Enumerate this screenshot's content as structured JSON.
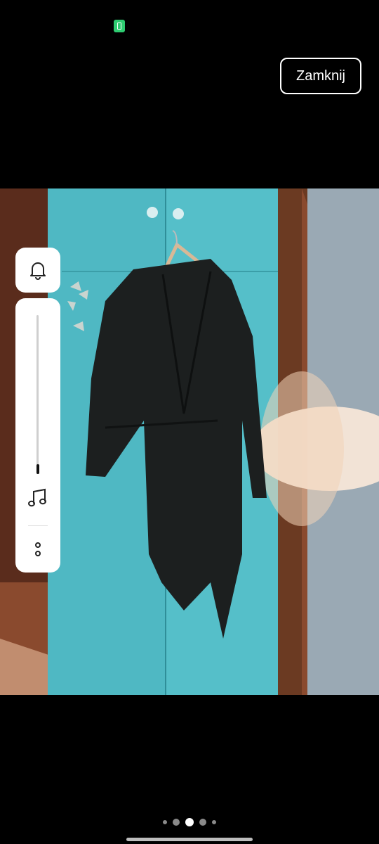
{
  "close_button": {
    "label": "Zamknij"
  },
  "volume": {
    "level": 0.06
  },
  "pager": {
    "count": 5,
    "active_index": 2
  },
  "icons": {
    "status": "battery-saver-icon",
    "bell": "bell-icon",
    "music": "music-note-icon",
    "more": "more-dots-icon"
  },
  "colors": {
    "background": "#000000",
    "panel": "#ffffff",
    "wardrobe": "#5fc3cc",
    "garment": "#1c1f1f"
  }
}
